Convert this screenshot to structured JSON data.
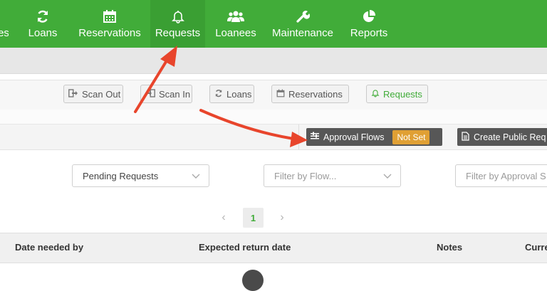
{
  "nav": {
    "partial_label": "es",
    "items": [
      {
        "label": "Loans",
        "icon": "refresh-icon"
      },
      {
        "label": "Reservations",
        "icon": "calendar-icon"
      },
      {
        "label": "Requests",
        "icon": "bell-icon",
        "active": true
      },
      {
        "label": "Loanees",
        "icon": "users-icon"
      },
      {
        "label": "Maintenance",
        "icon": "wrench-icon"
      },
      {
        "label": "Reports",
        "icon": "pie-chart-icon"
      }
    ]
  },
  "tabs": [
    {
      "label": "Scan Out",
      "icon": "sign-out-icon"
    },
    {
      "label": "Scan In",
      "icon": "sign-in-icon"
    },
    {
      "label": "Loans",
      "icon": "refresh-icon"
    },
    {
      "label": "Reservations",
      "icon": "calendar-icon"
    },
    {
      "label": "Requests",
      "icon": "bell-icon",
      "active": true
    }
  ],
  "actions": {
    "approval_flows_label": "Approval Flows",
    "approval_flows_badge": "Not Set",
    "create_public_label": "Create Public Req"
  },
  "filters": {
    "status_value": "Pending Requests",
    "flow_placeholder": "Filter by Flow...",
    "approval_placeholder": "Filter by Approval S"
  },
  "pagination": {
    "current": "1",
    "prev": "‹",
    "next": "›"
  },
  "table": {
    "columns": [
      "Date needed by",
      "Expected return date",
      "Notes",
      "Curre"
    ]
  },
  "colors": {
    "brand_green": "#41ac39",
    "badge_orange": "#e0a034",
    "arrow_red": "#e8452c"
  }
}
